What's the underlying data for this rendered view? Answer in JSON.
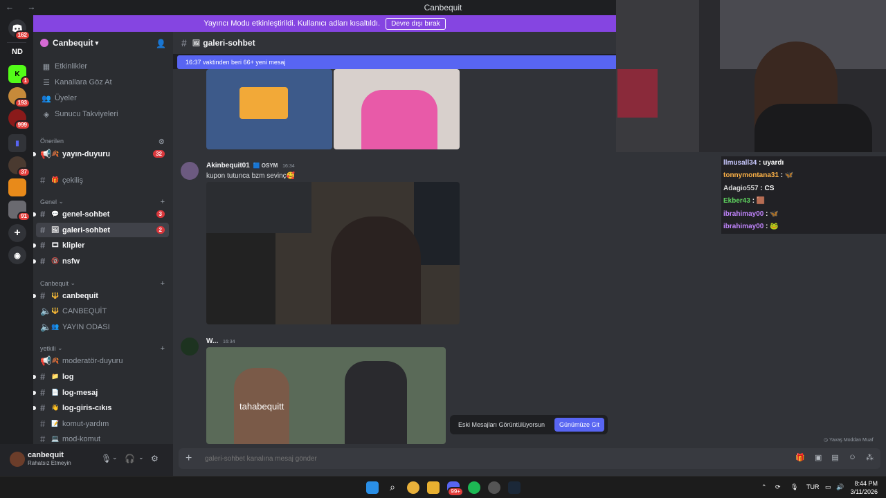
{
  "window": {
    "title": "Canbequit",
    "nav": "← →"
  },
  "streamer_banner": {
    "text": "Yayıncı Modu etkinleştirildi. Kullanıcı adları kısaltıldı.",
    "button": "Devre dışı bırak"
  },
  "rail": {
    "dm_badge": "162",
    "server_initials": "ND",
    "badges": [
      "1",
      "193",
      "999",
      "37",
      "91"
    ]
  },
  "server": {
    "name": "Canbequit"
  },
  "sidebar": {
    "nav": [
      "Etkinlikler",
      "Kanallara Göz At",
      "Üyeler",
      "Sunucu Takviyeleri"
    ],
    "categories": {
      "suggested": "Önerilen",
      "general": "Genel",
      "canbequit": "Canbequit",
      "yetkili": "yetkili"
    },
    "channels": {
      "yayin_duyuru": {
        "name": "yayın-duyuru",
        "count": "32"
      },
      "cekilis": {
        "name": "çekiliş"
      },
      "genel_sohbet": {
        "name": "genel-sohbet",
        "count": "3"
      },
      "galeri_sohbet": {
        "name": "galeri-sohbet",
        "count": "2"
      },
      "klipler": {
        "name": "klipler"
      },
      "nsfw": {
        "name": "nsfw"
      },
      "canbequit": {
        "name": "canbequit"
      },
      "canbequit_voice": {
        "name": "CANBEQUİT"
      },
      "yayin_odasi": {
        "name": "YAYIN ODASI"
      },
      "moderator_duyuru": {
        "name": "moderatör-duyuru"
      },
      "log": {
        "name": "log"
      },
      "log_mesaj": {
        "name": "log-mesaj"
      },
      "log_giris": {
        "name": "log-giris-cıkıs"
      },
      "komut_yardim": {
        "name": "komut-yardım"
      },
      "mod_komut": {
        "name": "mod-komut"
      }
    }
  },
  "user": {
    "name": "canbequit",
    "status": "Rahatsız Etmeyin"
  },
  "chat": {
    "channel": "galeri-sohbet",
    "new_messages": "16:37 vaktinden beri 66+ yeni mesaj",
    "messages": [
      {
        "author": "Akinbequit01",
        "tag": "OSYM",
        "time": "16:34",
        "text": "kupon tutunca bzm sevinç🥰"
      },
      {
        "author": "W...",
        "time": "16:34",
        "caption": "tahabequitt"
      }
    ],
    "old_messages_notice": "Eski Mesajları Görüntülüyorsun",
    "jump_button": "Günümüze Git",
    "slowmode": "Yavaş Moddan Muaf",
    "input_placeholder": "galeri-sohbet kanalına mesaj gönder"
  },
  "twitch_chat": [
    {
      "user": "llmusall34",
      "msg": "uyardı",
      "color": "#c9c9ff"
    },
    {
      "user": "tonnymontana31",
      "msg": "🦋",
      "color": "#ffb347"
    },
    {
      "user": "Adagio557",
      "msg": "CS",
      "color": "#d9d9d9"
    },
    {
      "user": "Ekber43",
      "msg": "🟫",
      "color": "#5fd35f"
    },
    {
      "user": "ibrahimay00",
      "msg": "🦋",
      "color": "#c084fc"
    },
    {
      "user": "ibrahimay00",
      "msg": "🐸",
      "color": "#c084fc"
    }
  ],
  "taskbar": {
    "lang": "TUR",
    "time": "8:44 PM",
    "date": "3/11/2026",
    "discord_badge": "99+"
  }
}
